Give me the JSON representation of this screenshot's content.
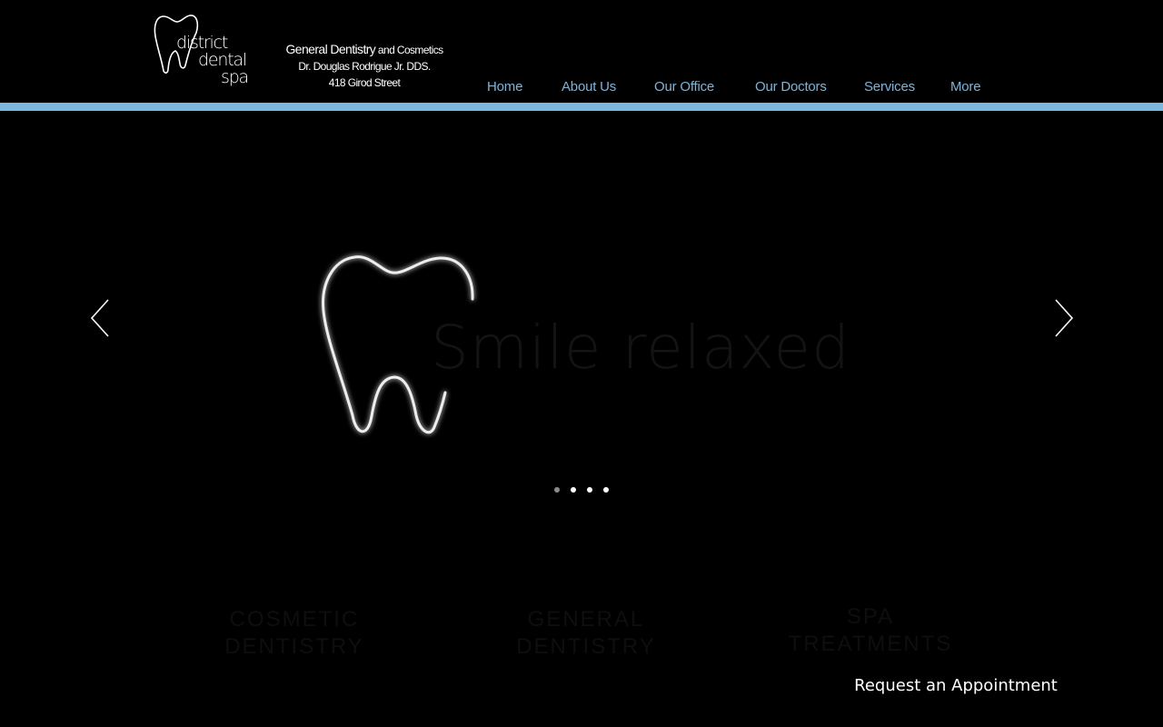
{
  "logo": {
    "word1": "district",
    "word2": "dental",
    "word3": "spa",
    "icon": "tooth-outline-icon"
  },
  "tagline": {
    "line1_main": "General Dentistry",
    "line1_small": " and Cosmetics",
    "line2": "Dr. Douglas Rodrigue Jr. DDS.",
    "line3": "418 Girod Street"
  },
  "nav": {
    "items": [
      {
        "label": "Home"
      },
      {
        "label": "About Us"
      },
      {
        "label": "Our Office"
      },
      {
        "label": "Our Doctors"
      },
      {
        "label": "Services"
      },
      {
        "label": "More"
      }
    ]
  },
  "colors": {
    "accent": "#7cb7de",
    "nav_text": "#7fb3d9",
    "background": "#000000"
  },
  "slider": {
    "title": "Smile relaxed",
    "prev_icon": "chevron-left-icon",
    "next_icon": "chevron-right-icon",
    "slide_icon": "tooth-outline-icon",
    "dot_count": 4,
    "active_index": 0
  },
  "services": {
    "cosmetic": {
      "line1": "COSMETIC",
      "line2": "DENTISTRY"
    },
    "general": {
      "line1": "GENERAL",
      "line2": "DENTISTRY"
    },
    "spa": {
      "line1": "SPA",
      "line2": "TREATMENTS"
    }
  },
  "cta": {
    "label": "Request an Appointment"
  }
}
